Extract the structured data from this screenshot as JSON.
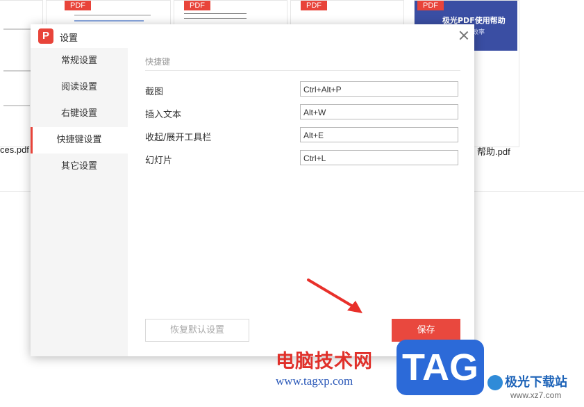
{
  "background": {
    "pdf_label": "PDF",
    "files": [
      {
        "name": "ces.pdf"
      },
      {
        "name": "帮助.pdf"
      }
    ],
    "help_cover": {
      "title": "极光PDF使用帮助",
      "subtitle": "公更有效率"
    }
  },
  "dialog": {
    "title": "设置",
    "logo_letter": "P",
    "sidebar": {
      "items": [
        {
          "label": "常规设置"
        },
        {
          "label": "阅读设置"
        },
        {
          "label": "右键设置"
        },
        {
          "label": "快捷键设置"
        },
        {
          "label": "其它设置"
        }
      ],
      "active_index": 3
    },
    "section_title": "快捷键",
    "hotkeys": [
      {
        "label": "截图",
        "value": "Ctrl+Alt+P"
      },
      {
        "label": "插入文本",
        "value": "Alt+W"
      },
      {
        "label": "收起/展开工具栏",
        "value": "Alt+E"
      },
      {
        "label": "幻灯片",
        "value": "Ctrl+L"
      }
    ],
    "buttons": {
      "reset": "恢复默认设置",
      "save": "保存"
    }
  },
  "watermark": {
    "site_name": "电脑技术网",
    "site_url": "www.tagxp.com",
    "tag": "TAG",
    "brand_name": "极光下载站",
    "brand_url": "www.xz7.com"
  },
  "colors": {
    "accent": "#e8443a",
    "save_button": "#e9483e",
    "tag_blue": "#2c6ad8"
  }
}
